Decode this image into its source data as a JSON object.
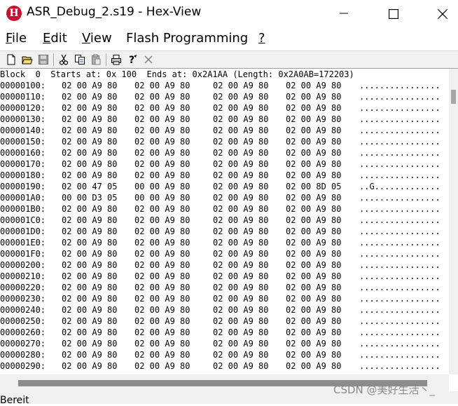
{
  "window": {
    "title": "ASR_Debug_2.s19 - Hex-View",
    "icon_letter": "H",
    "buttons": [
      "minimize-icon",
      "maximize-icon",
      "close-icon"
    ]
  },
  "menu": {
    "items": [
      {
        "pre": "",
        "key": "F",
        "rest": "ile"
      },
      {
        "pre": "",
        "key": "E",
        "rest": "dit"
      },
      {
        "pre": "",
        "key": "V",
        "rest": "iew"
      },
      {
        "pre": "Flash Programming",
        "key": "",
        "rest": ""
      },
      {
        "pre": "",
        "key": "?",
        "rest": ""
      }
    ]
  },
  "toolbar": {
    "buttons": [
      "new-file-icon",
      "open-folder-icon",
      "save-icon",
      "cut-icon",
      "copy-icon",
      "paste-icon",
      "print-icon",
      "help-icon",
      "close-x-icon"
    ]
  },
  "hex": {
    "header": "Block  0  Starts at: 0x 100  Ends at: 0x2A1AA (Length: 0x2A0AB=172203)",
    "rows": [
      {
        "addr": "00000100:",
        "g1": "02 00 A9 80",
        "g2": "02 00 A9 80",
        "g3": "02 00 A9 80",
        "g4": "02 00 A9 80",
        "ascii": "................"
      },
      {
        "addr": "00000110:",
        "g1": "02 00 A9 80",
        "g2": "02 00 A9 80",
        "g3": "02 00 A9 80",
        "g4": "02 00 A9 80",
        "ascii": "................"
      },
      {
        "addr": "00000120:",
        "g1": "02 00 A9 80",
        "g2": "02 00 A9 80",
        "g3": "02 00 A9 80",
        "g4": "02 00 A9 80",
        "ascii": "................"
      },
      {
        "addr": "00000130:",
        "g1": "02 00 A9 80",
        "g2": "02 00 A9 80",
        "g3": "02 00 A9 80",
        "g4": "02 00 A9 80",
        "ascii": "................"
      },
      {
        "addr": "00000140:",
        "g1": "02 00 A9 80",
        "g2": "02 00 A9 80",
        "g3": "02 00 A9 80",
        "g4": "02 00 A9 80",
        "ascii": "................"
      },
      {
        "addr": "00000150:",
        "g1": "02 00 A9 80",
        "g2": "02 00 A9 80",
        "g3": "02 00 A9 80",
        "g4": "02 00 A9 80",
        "ascii": "................"
      },
      {
        "addr": "00000160:",
        "g1": "02 00 A9 80",
        "g2": "02 00 A9 80",
        "g3": "02 00 A9 80",
        "g4": "02 00 A9 80",
        "ascii": "................"
      },
      {
        "addr": "00000170:",
        "g1": "02 00 A9 80",
        "g2": "02 00 A9 80",
        "g3": "02 00 A9 80",
        "g4": "02 00 A9 80",
        "ascii": "................"
      },
      {
        "addr": "00000180:",
        "g1": "02 00 A9 80",
        "g2": "02 00 A9 80",
        "g3": "02 00 A9 80",
        "g4": "02 00 A9 80",
        "ascii": "................"
      },
      {
        "addr": "00000190:",
        "g1": "02 00 47 05",
        "g2": "00 00 A9 80",
        "g3": "02 00 A9 80",
        "g4": "02 00 8D 05",
        "ascii": "..G............."
      },
      {
        "addr": "000001A0:",
        "g1": "00 00 D3 05",
        "g2": "00 00 A9 80",
        "g3": "02 00 A9 80",
        "g4": "02 00 A9 80",
        "ascii": "................"
      },
      {
        "addr": "000001B0:",
        "g1": "02 00 A9 80",
        "g2": "02 00 A9 80",
        "g3": "02 00 A9 80",
        "g4": "02 00 A9 80",
        "ascii": "................"
      },
      {
        "addr": "000001C0:",
        "g1": "02 00 A9 80",
        "g2": "02 00 A9 80",
        "g3": "02 00 A9 80",
        "g4": "02 00 A9 80",
        "ascii": "................"
      },
      {
        "addr": "000001D0:",
        "g1": "02 00 A9 80",
        "g2": "02 00 A9 80",
        "g3": "02 00 A9 80",
        "g4": "02 00 A9 80",
        "ascii": "................"
      },
      {
        "addr": "000001E0:",
        "g1": "02 00 A9 80",
        "g2": "02 00 A9 80",
        "g3": "02 00 A9 80",
        "g4": "02 00 A9 80",
        "ascii": "................"
      },
      {
        "addr": "000001F0:",
        "g1": "02 00 A9 80",
        "g2": "02 00 A9 80",
        "g3": "02 00 A9 80",
        "g4": "02 00 A9 80",
        "ascii": "................"
      },
      {
        "addr": "00000200:",
        "g1": "02 00 A9 80",
        "g2": "02 00 A9 80",
        "g3": "02 00 A9 80",
        "g4": "02 00 A9 80",
        "ascii": "................"
      },
      {
        "addr": "00000210:",
        "g1": "02 00 A9 80",
        "g2": "02 00 A9 80",
        "g3": "02 00 A9 80",
        "g4": "02 00 A9 80",
        "ascii": "................"
      },
      {
        "addr": "00000220:",
        "g1": "02 00 A9 80",
        "g2": "02 00 A9 80",
        "g3": "02 00 A9 80",
        "g4": "02 00 A9 80",
        "ascii": "................"
      },
      {
        "addr": "00000230:",
        "g1": "02 00 A9 80",
        "g2": "02 00 A9 80",
        "g3": "02 00 A9 80",
        "g4": "02 00 A9 80",
        "ascii": "................"
      },
      {
        "addr": "00000240:",
        "g1": "02 00 A9 80",
        "g2": "02 00 A9 80",
        "g3": "02 00 A9 80",
        "g4": "02 00 A9 80",
        "ascii": "................"
      },
      {
        "addr": "00000250:",
        "g1": "02 00 A9 80",
        "g2": "02 00 A9 80",
        "g3": "02 00 A9 80",
        "g4": "02 00 A9 80",
        "ascii": "................"
      },
      {
        "addr": "00000260:",
        "g1": "02 00 A9 80",
        "g2": "02 00 A9 80",
        "g3": "02 00 A9 80",
        "g4": "02 00 A9 80",
        "ascii": "................"
      },
      {
        "addr": "00000270:",
        "g1": "02 00 A9 80",
        "g2": "02 00 A9 80",
        "g3": "02 00 A9 80",
        "g4": "02 00 A9 80",
        "ascii": "................"
      },
      {
        "addr": "00000280:",
        "g1": "02 00 A9 80",
        "g2": "02 00 A9 80",
        "g3": "02 00 A9 80",
        "g4": "02 00 A9 80",
        "ascii": "................"
      },
      {
        "addr": "00000290:",
        "g1": "02 00 A9 80",
        "g2": "02 00 A9 80",
        "g3": "02 00 A9 80",
        "g4": "02 00 A9 80",
        "ascii": "................"
      }
    ]
  },
  "status": {
    "text": "Bereit"
  },
  "watermark": {
    "text": "CSDN @美好生活丶_"
  },
  "colors": {
    "app_icon": "#c8102e",
    "chrome": "#f0f0f0",
    "scroll_thumb": "#8c8c8c"
  }
}
